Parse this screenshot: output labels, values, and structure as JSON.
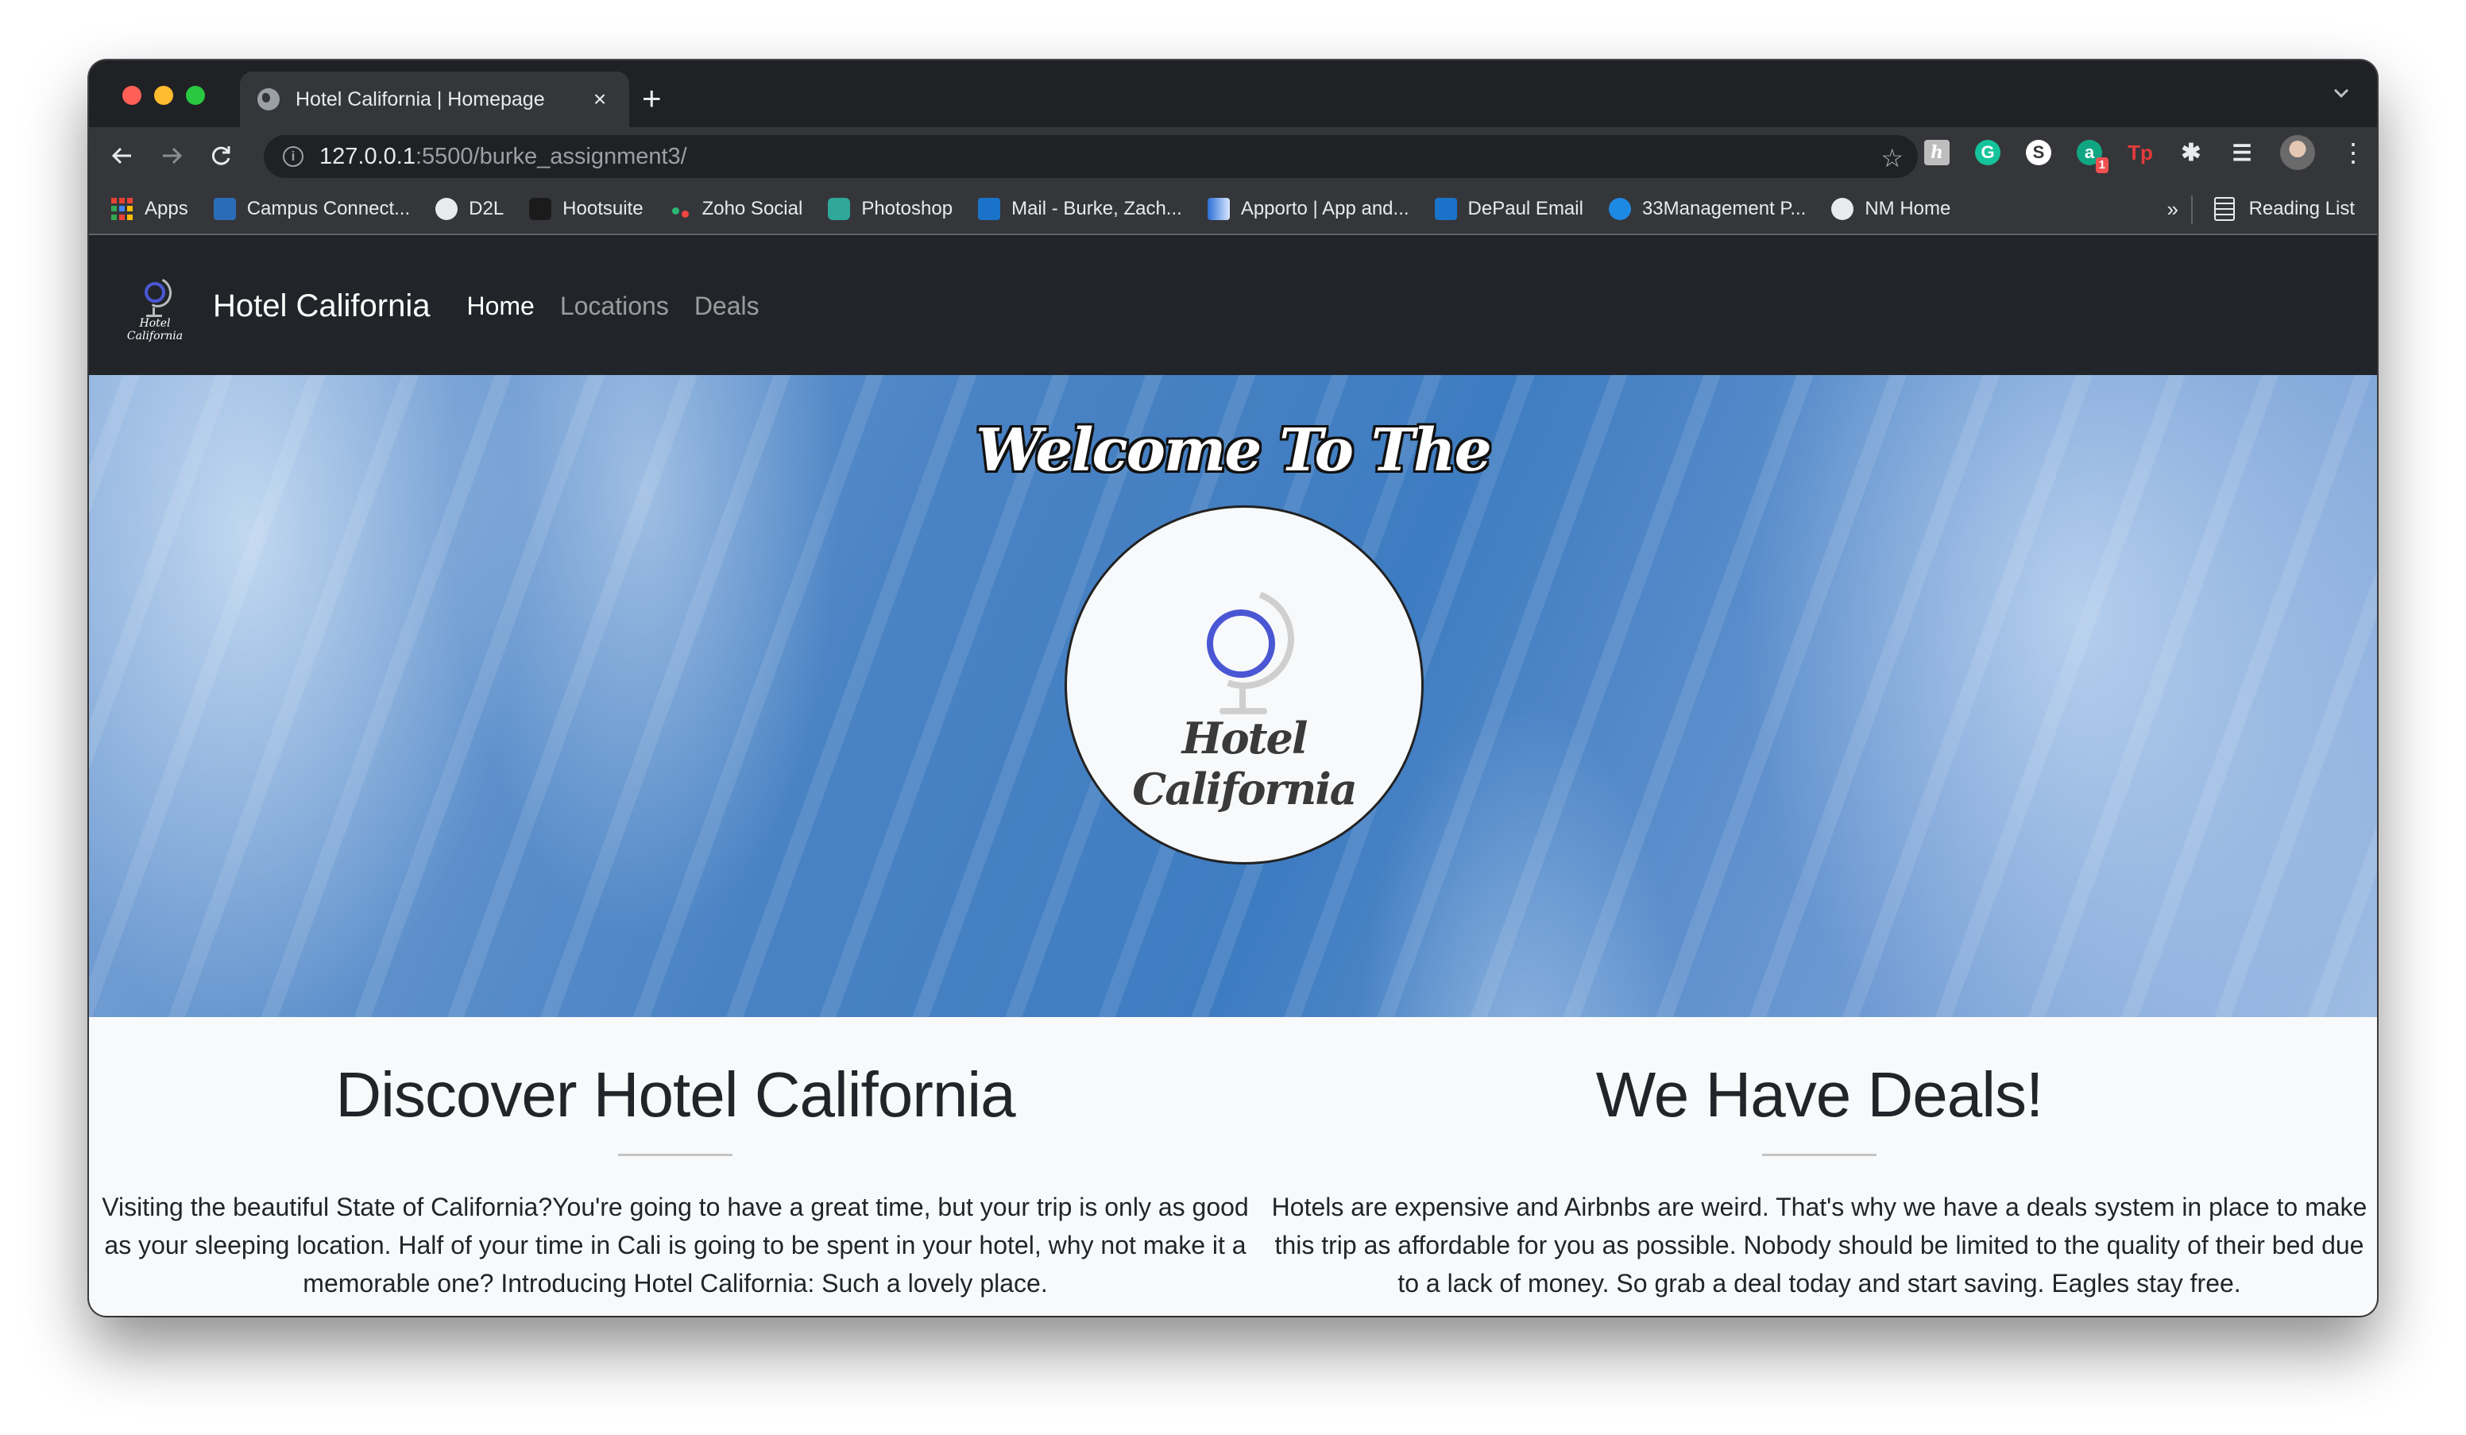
{
  "browser": {
    "tab_title": "Hotel California | Homepage",
    "new_tab_label": "+",
    "url_host": "127.0.0.1",
    "url_rest": ":5500/burke_assignment3/",
    "extensions": [
      {
        "name": "honey",
        "glyph": "h"
      },
      {
        "name": "grammarly",
        "glyph": "G"
      },
      {
        "name": "s-extension",
        "glyph": "S"
      },
      {
        "name": "a-extension",
        "glyph": "a",
        "badge": "1"
      },
      {
        "name": "tp-extension",
        "glyph": "Tp"
      },
      {
        "name": "extensions-puzzle",
        "glyph": "✱"
      },
      {
        "name": "media-control",
        "glyph": "☰"
      }
    ],
    "bookmarks": [
      {
        "label": "Apps",
        "icon": "apps-grid-icon"
      },
      {
        "label": "Campus Connect...",
        "icon": "campus-connect-icon"
      },
      {
        "label": "D2L",
        "icon": "globe-icon"
      },
      {
        "label": "Hootsuite",
        "icon": "hootsuite-icon"
      },
      {
        "label": "Zoho Social",
        "icon": "zoho-icon"
      },
      {
        "label": "Photoshop",
        "icon": "photoshop-icon"
      },
      {
        "label": "Mail - Burke, Zach...",
        "icon": "outlook-icon"
      },
      {
        "label": "Apporto | App and...",
        "icon": "apporto-icon"
      },
      {
        "label": "DePaul Email",
        "icon": "outlook-icon"
      },
      {
        "label": "33Management P...",
        "icon": "33management-icon"
      },
      {
        "label": "NM Home",
        "icon": "globe-icon"
      }
    ],
    "bookmarks_overflow": "»",
    "reading_list": "Reading List"
  },
  "site": {
    "nav": {
      "logo_script": "Hotel California",
      "brand": "Hotel California",
      "links": [
        {
          "label": "Home",
          "active": true
        },
        {
          "label": "Locations",
          "active": false
        },
        {
          "label": "Deals",
          "active": false
        }
      ]
    },
    "hero": {
      "welcome": "Welcome To The",
      "logo_script": "Hotel California"
    },
    "sections": [
      {
        "title": "Discover Hotel California",
        "body": "Visiting the beautiful State of California?You're going to have a great time, but your trip is only as good as your sleeping location. Half of your time in Cali is going to be spent in your hotel, why not make it a memorable one? Introducing Hotel California: Such a lovely place."
      },
      {
        "title": "We Have Deals!",
        "body": "Hotels are expensive and Airbnbs are weird. That's why we have a deals system in place to make this trip as affordable for you as possible. Nobody should be limited to the quality of their bed due to a lack of money. So grab a deal today and start saving. Eagles stay free."
      }
    ]
  }
}
